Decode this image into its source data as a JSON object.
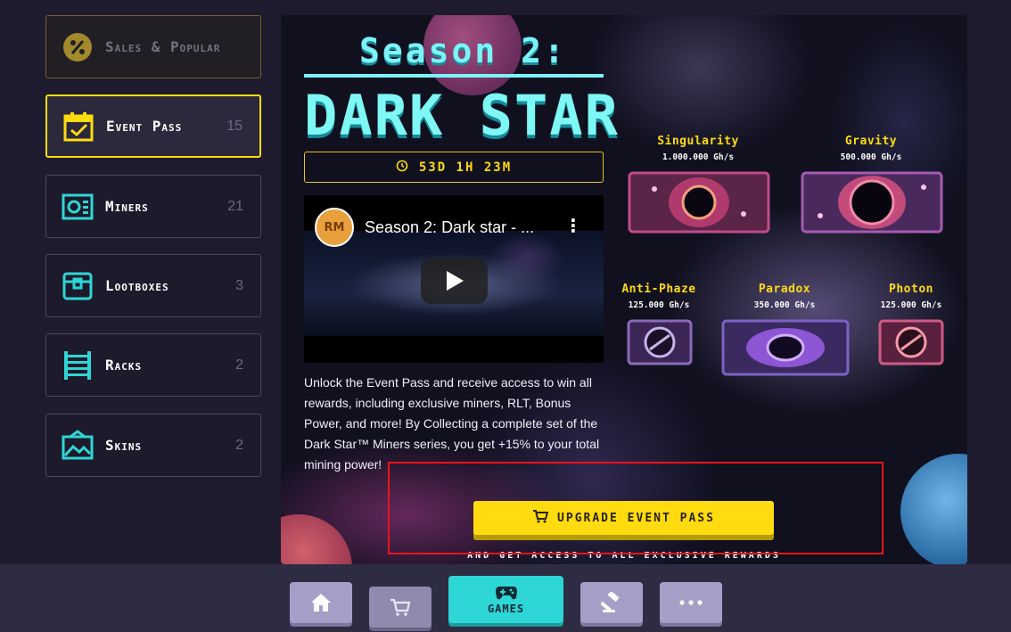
{
  "sidebar": {
    "items": [
      {
        "label": "Sales & Popular",
        "count": ""
      },
      {
        "label": "Event Pass",
        "count": "15"
      },
      {
        "label": "Miners",
        "count": "21"
      },
      {
        "label": "Lootboxes",
        "count": "3"
      },
      {
        "label": "Racks",
        "count": "2"
      },
      {
        "label": "Skins",
        "count": "2"
      }
    ]
  },
  "banner": {
    "season_title": "Season 2:",
    "event_name": "DARK STAR",
    "timer": "53D 1H 23M",
    "video_title": "Season 2: Dark star - ...",
    "description": "Unlock the Event Pass and receive access to win all rewards, including exclusive miners, RLT, Bonus Power, and more! By Collecting a complete set of the Dark Star™ Miners series, you get +15% to your total mining power!",
    "upgrade_label": "UPGRADE EVENT PASS",
    "access_note": "AND GET ACCESS TO ALL EXCLUSIVE REWARDS",
    "miners": [
      {
        "name": "Singularity",
        "rate": "1.000.000 Gh/s",
        "icon": "singularity-miner"
      },
      {
        "name": "Gravity",
        "rate": "500.000 Gh/s",
        "icon": "gravity-miner"
      },
      {
        "name": "Anti-Phaze",
        "rate": "125.000 Gh/s",
        "icon": "anti-phaze-miner"
      },
      {
        "name": "Paradox",
        "rate": "350.000 Gh/s",
        "icon": "paradox-miner"
      },
      {
        "name": "Photon",
        "rate": "125.000 Gh/s",
        "icon": "photon-miner"
      }
    ]
  },
  "bottom_nav": {
    "games_label": "GAMES",
    "items": [
      "home-icon",
      "cart-icon",
      "games-icon",
      "auction-icon",
      "more-icon"
    ]
  },
  "colors": {
    "accent": "#ffdb10",
    "cyan": "#2ed6d6",
    "background": "#1d1b2d"
  }
}
